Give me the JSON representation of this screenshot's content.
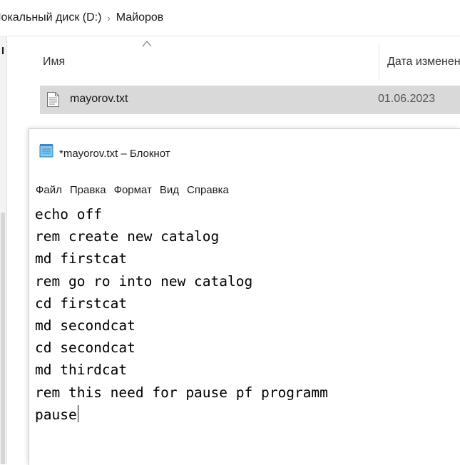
{
  "explorer": {
    "breadcrumb": [
      "Локальный диск (D:)",
      "Майоров"
    ],
    "breadcrumb_separator": "›",
    "columns": {
      "name": "Имя",
      "date": "Дата изменения"
    },
    "sort_indicator": "chevron-up-icon",
    "selected_row_color": "#d9d9d9",
    "file": {
      "name": "mayorov.txt",
      "date": "01.06.2023",
      "icon": "text-file-icon"
    }
  },
  "notepad": {
    "title": "*mayorov.txt – Блокнот",
    "icon": "notepad-icon",
    "menu": [
      "Файл",
      "Правка",
      "Формат",
      "Вид",
      "Справка"
    ],
    "lines": [
      "echo off",
      "rem create new catalog",
      "md firstcat",
      "rem go ro into new catalog",
      "cd firstcat",
      "md secondcat",
      "cd secondcat",
      "md thirdcat",
      "rem this need for pause pf programm",
      "pause"
    ]
  }
}
